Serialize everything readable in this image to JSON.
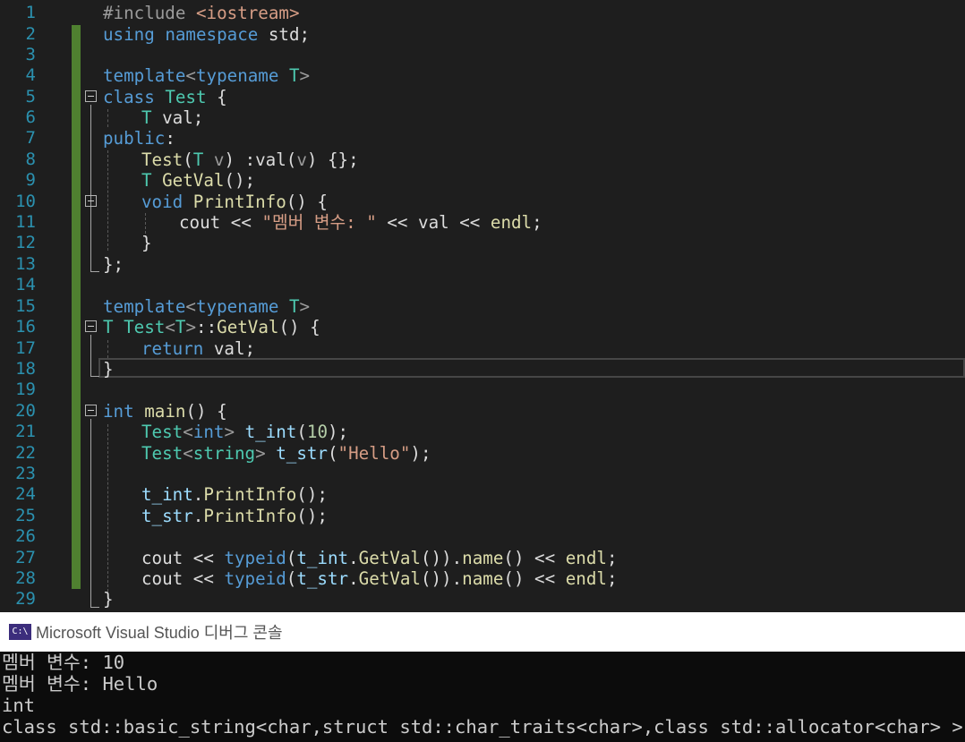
{
  "editor": {
    "line_numbers": [
      "1",
      "2",
      "3",
      "4",
      "5",
      "6",
      "7",
      "8",
      "9",
      "10",
      "11",
      "12",
      "13",
      "14",
      "15",
      "16",
      "17",
      "18",
      "19",
      "20",
      "21",
      "22",
      "23",
      "24",
      "25",
      "26",
      "27",
      "28",
      "29"
    ],
    "tokens": {
      "include_directive": "#include",
      "include_file": "<iostream>",
      "using": "using",
      "namespace": "namespace",
      "std": "std",
      "semi": ";",
      "template": "template",
      "lt": "<",
      "gt": ">",
      "typename": "typename",
      "T": "T",
      "class": "class",
      "Test": "Test",
      "open_brace": " {",
      "val": "val",
      "public": "public",
      "colon": ":",
      "v": "v",
      "ctor_mid": ") :",
      "ctor_end": ") {};",
      "open_paren": "(",
      "GetVal": "GetVal",
      "empty_call_semi": "();",
      "void": "void",
      "PrintInfo": "PrintInfo",
      "empty_call_brace": "() {",
      "cout": "cout",
      "shift": " << ",
      "member_str": "\"멤버 변수: \"",
      "endl": "endl",
      "close_brace": "}",
      "close_brace_semi": "};",
      "scope": "::",
      "return": "return",
      "int": "int",
      "main": "main",
      "t_int": "t_int",
      "arg_10": "10",
      "close_paren_semi": ");",
      "string": "string",
      "t_str": "t_str",
      "hello_str": "\"Hello\"",
      "dot": ".",
      "typeid": "typeid",
      "close_parens_2": "()).",
      "name": "name",
      "empty_parens": "()",
      "space": " "
    }
  },
  "console": {
    "title": "Microsoft Visual Studio 디버그 콘솔",
    "icon_label": "C:\\",
    "lines": [
      "멤버 변수: 10",
      "멤버 변수: Hello",
      "int",
      "class std::basic_string<char,struct std::char_traits<char>,class std::allocator<char> >"
    ]
  }
}
